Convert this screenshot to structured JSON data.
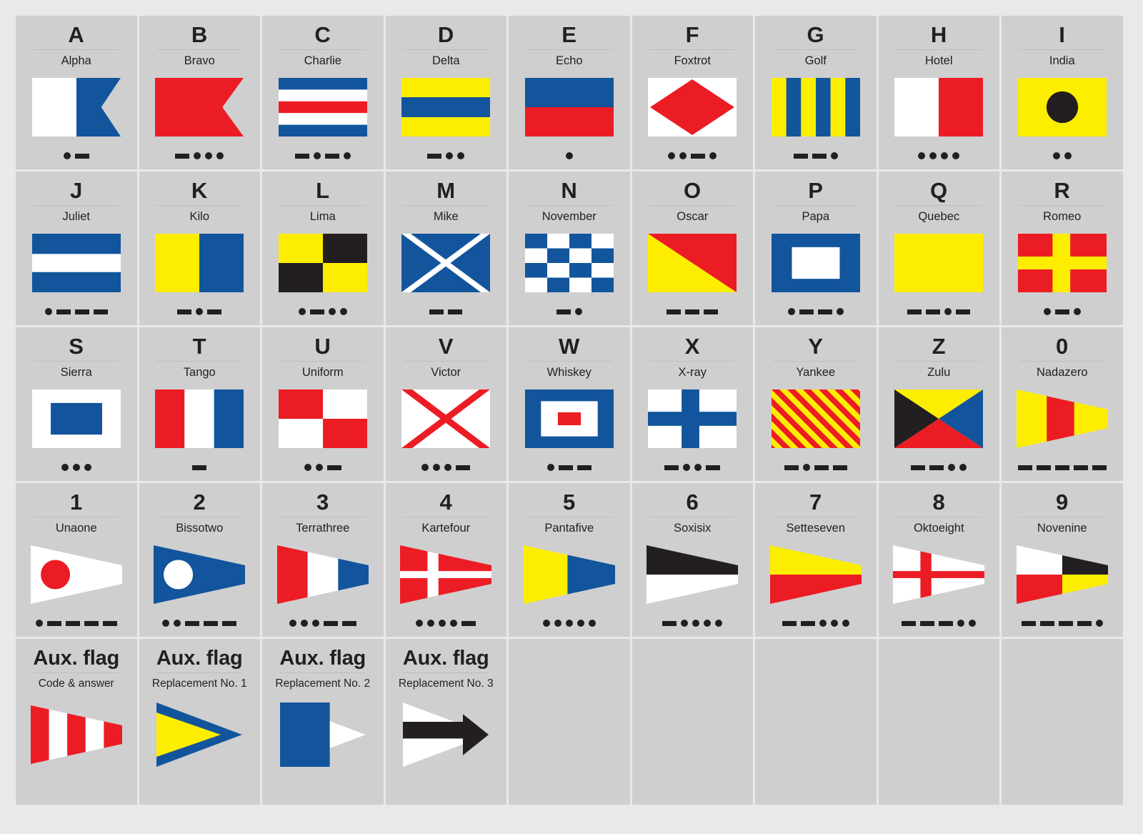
{
  "meta": {
    "background": "#e9e9e9",
    "cell_background": "#cfcfcf",
    "palette": {
      "blue": "#12559c",
      "red": "#ec1c24",
      "yellow": "#fdee00",
      "black": "#231f20",
      "white": "#ffffff"
    }
  },
  "rows": [
    {
      "cells": [
        {
          "letter": "A",
          "name": "Alpha",
          "flag": "alpha",
          "morse": [
            ".",
            "-"
          ]
        },
        {
          "letter": "B",
          "name": "Bravo",
          "flag": "bravo",
          "morse": [
            "-",
            ".",
            ".",
            "."
          ]
        },
        {
          "letter": "C",
          "name": "Charlie",
          "flag": "charlie",
          "morse": [
            "-",
            ".",
            "-",
            "."
          ]
        },
        {
          "letter": "D",
          "name": "Delta",
          "flag": "delta",
          "morse": [
            "-",
            ".",
            "."
          ]
        },
        {
          "letter": "E",
          "name": "Echo",
          "flag": "echo",
          "morse": [
            "."
          ]
        },
        {
          "letter": "F",
          "name": "Foxtrot",
          "flag": "foxtrot",
          "morse": [
            ".",
            ".",
            "-",
            "."
          ]
        },
        {
          "letter": "G",
          "name": "Golf",
          "flag": "golf",
          "morse": [
            "-",
            "-",
            "."
          ]
        },
        {
          "letter": "H",
          "name": "Hotel",
          "flag": "hotel",
          "morse": [
            ".",
            ".",
            ".",
            "."
          ]
        },
        {
          "letter": "I",
          "name": "India",
          "flag": "india",
          "morse": [
            ".",
            "."
          ]
        }
      ]
    },
    {
      "cells": [
        {
          "letter": "J",
          "name": "Juliet",
          "flag": "juliet",
          "morse": [
            ".",
            "-",
            "-",
            "-"
          ]
        },
        {
          "letter": "K",
          "name": "Kilo",
          "flag": "kilo",
          "morse": [
            "-",
            ".",
            "-"
          ]
        },
        {
          "letter": "L",
          "name": "Lima",
          "flag": "lima",
          "morse": [
            ".",
            "-",
            ".",
            "."
          ]
        },
        {
          "letter": "M",
          "name": "Mike",
          "flag": "mike",
          "morse": [
            "-",
            "-"
          ]
        },
        {
          "letter": "N",
          "name": "November",
          "flag": "november",
          "morse": [
            "-",
            "."
          ]
        },
        {
          "letter": "O",
          "name": "Oscar",
          "flag": "oscar",
          "morse": [
            "-",
            "-",
            "-"
          ]
        },
        {
          "letter": "P",
          "name": "Papa",
          "flag": "papa",
          "morse": [
            ".",
            "-",
            "-",
            "."
          ]
        },
        {
          "letter": "Q",
          "name": "Quebec",
          "flag": "quebec",
          "morse": [
            "-",
            "-",
            ".",
            "-"
          ]
        },
        {
          "letter": "R",
          "name": "Romeo",
          "flag": "romeo",
          "morse": [
            ".",
            "-",
            "."
          ]
        }
      ]
    },
    {
      "cells": [
        {
          "letter": "S",
          "name": "Sierra",
          "flag": "sierra",
          "morse": [
            ".",
            ".",
            "."
          ]
        },
        {
          "letter": "T",
          "name": "Tango",
          "flag": "tango",
          "morse": [
            "-"
          ]
        },
        {
          "letter": "U",
          "name": "Uniform",
          "flag": "uniform",
          "morse": [
            ".",
            ".",
            "-"
          ]
        },
        {
          "letter": "V",
          "name": "Victor",
          "flag": "victor",
          "morse": [
            ".",
            ".",
            ".",
            "-"
          ]
        },
        {
          "letter": "W",
          "name": "Whiskey",
          "flag": "whiskey",
          "morse": [
            ".",
            "-",
            "-"
          ]
        },
        {
          "letter": "X",
          "name": "X-ray",
          "flag": "xray",
          "morse": [
            "-",
            ".",
            ".",
            "-"
          ]
        },
        {
          "letter": "Y",
          "name": "Yankee",
          "flag": "yankee",
          "morse": [
            "-",
            ".",
            "-",
            "-"
          ]
        },
        {
          "letter": "Z",
          "name": "Zulu",
          "flag": "zulu",
          "morse": [
            "-",
            "-",
            ".",
            "."
          ]
        },
        {
          "letter": "0",
          "name": "Nadazero",
          "flag": "nadazero",
          "morse": [
            "-",
            "-",
            "-",
            "-",
            "-"
          ]
        }
      ]
    },
    {
      "cells": [
        {
          "letter": "1",
          "name": "Unaone",
          "flag": "unaone",
          "morse": [
            ".",
            "-",
            "-",
            "-",
            "-"
          ]
        },
        {
          "letter": "2",
          "name": "Bissotwo",
          "flag": "bissotwo",
          "morse": [
            ".",
            ".",
            "-",
            "-",
            "-"
          ]
        },
        {
          "letter": "3",
          "name": "Terrathree",
          "flag": "terrathree",
          "morse": [
            ".",
            ".",
            ".",
            "-",
            "-"
          ]
        },
        {
          "letter": "4",
          "name": "Kartefour",
          "flag": "kartefour",
          "morse": [
            ".",
            ".",
            ".",
            ".",
            "-"
          ]
        },
        {
          "letter": "5",
          "name": "Pantafive",
          "flag": "pantafive",
          "morse": [
            ".",
            ".",
            ".",
            ".",
            "."
          ]
        },
        {
          "letter": "6",
          "name": "Soxisix",
          "flag": "soxisix",
          "morse": [
            "-",
            ".",
            ".",
            ".",
            "."
          ]
        },
        {
          "letter": "7",
          "name": "Setteseven",
          "flag": "setteseven",
          "morse": [
            "-",
            "-",
            ".",
            ".",
            "."
          ]
        },
        {
          "letter": "8",
          "name": "Oktoeight",
          "flag": "oktoeight",
          "morse": [
            "-",
            "-",
            "-",
            ".",
            "."
          ]
        },
        {
          "letter": "9",
          "name": "Novenine",
          "flag": "novenine",
          "morse": [
            "-",
            "-",
            "-",
            "-",
            "."
          ]
        }
      ]
    },
    {
      "aux": true,
      "cells": [
        {
          "letter": "Aux. flag",
          "name": "Code & answer",
          "flag": "aux-code",
          "morse": []
        },
        {
          "letter": "Aux. flag",
          "name": "Replacement No. 1",
          "flag": "aux-rep1",
          "morse": []
        },
        {
          "letter": "Aux. flag",
          "name": "Replacement No. 2",
          "flag": "aux-rep2",
          "morse": []
        },
        {
          "letter": "Aux. flag",
          "name": "Replacement No. 3",
          "flag": "aux-rep3",
          "morse": []
        }
      ],
      "blank_cells": 5
    }
  ]
}
